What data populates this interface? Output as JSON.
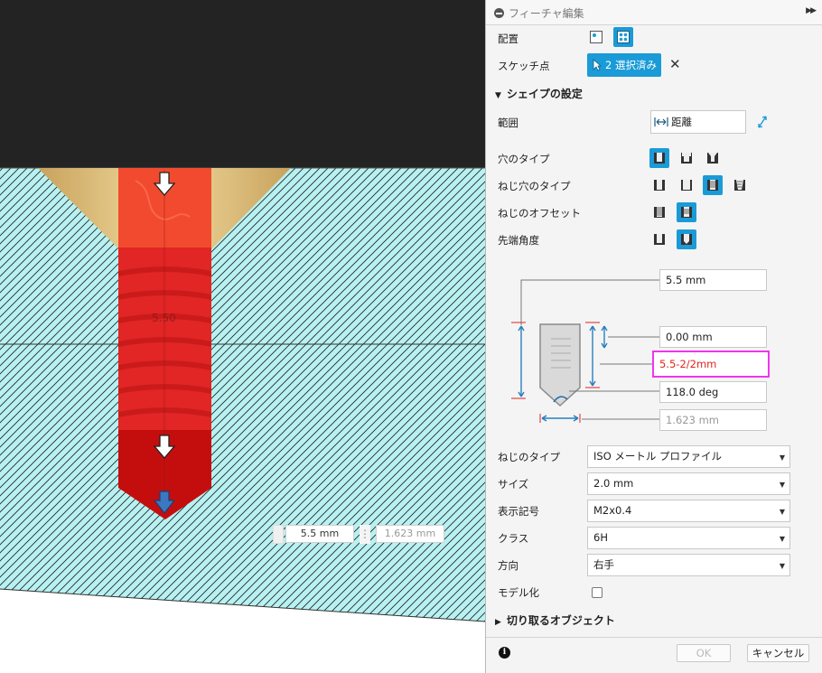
{
  "viewport": {
    "dimension_label": "5.50",
    "mini_toolbar": {
      "depth_value": "5.5 mm",
      "tip_value": "1.623 mm"
    }
  },
  "panel": {
    "title": "フィーチャ編集",
    "placement_label": "配置",
    "sketch_points_label": "スケッチ点",
    "sketch_points_button": "2 選択済み",
    "shape_section": "シェイプの設定",
    "range_label": "範囲",
    "range_value": "距離",
    "hole_type_label": "穴のタイプ",
    "tap_type_label": "ねじ穴のタイプ",
    "thread_offset_label": "ねじのオフセット",
    "tip_angle_label": "先端角度",
    "dims": {
      "depth": "5.5 mm",
      "offset": "0.00 mm",
      "thread_depth": "5.5-2/2mm",
      "angle": "118.0 deg",
      "diameter": "1.623 mm"
    },
    "thread_type_label": "ねじのタイプ",
    "thread_type_value": "ISO メートル プロファイル",
    "size_label": "サイズ",
    "size_value": "2.0 mm",
    "designation_label": "表示記号",
    "designation_value": "M2x0.4",
    "class_label": "クラス",
    "class_value": "6H",
    "direction_label": "方向",
    "direction_value": "右手",
    "modeled_label": "モデル化",
    "modeled_checked": false,
    "cut_section": "切り取るオブジェクト",
    "ok_label": "OK",
    "cancel_label": "キャンセル"
  },
  "colors": {
    "accent": "#1a9bd7",
    "error_text": "#e0261e",
    "highlight_border": "#f035f0",
    "viewport_dark": "#232323",
    "section_fill": "#b8f1f1"
  }
}
